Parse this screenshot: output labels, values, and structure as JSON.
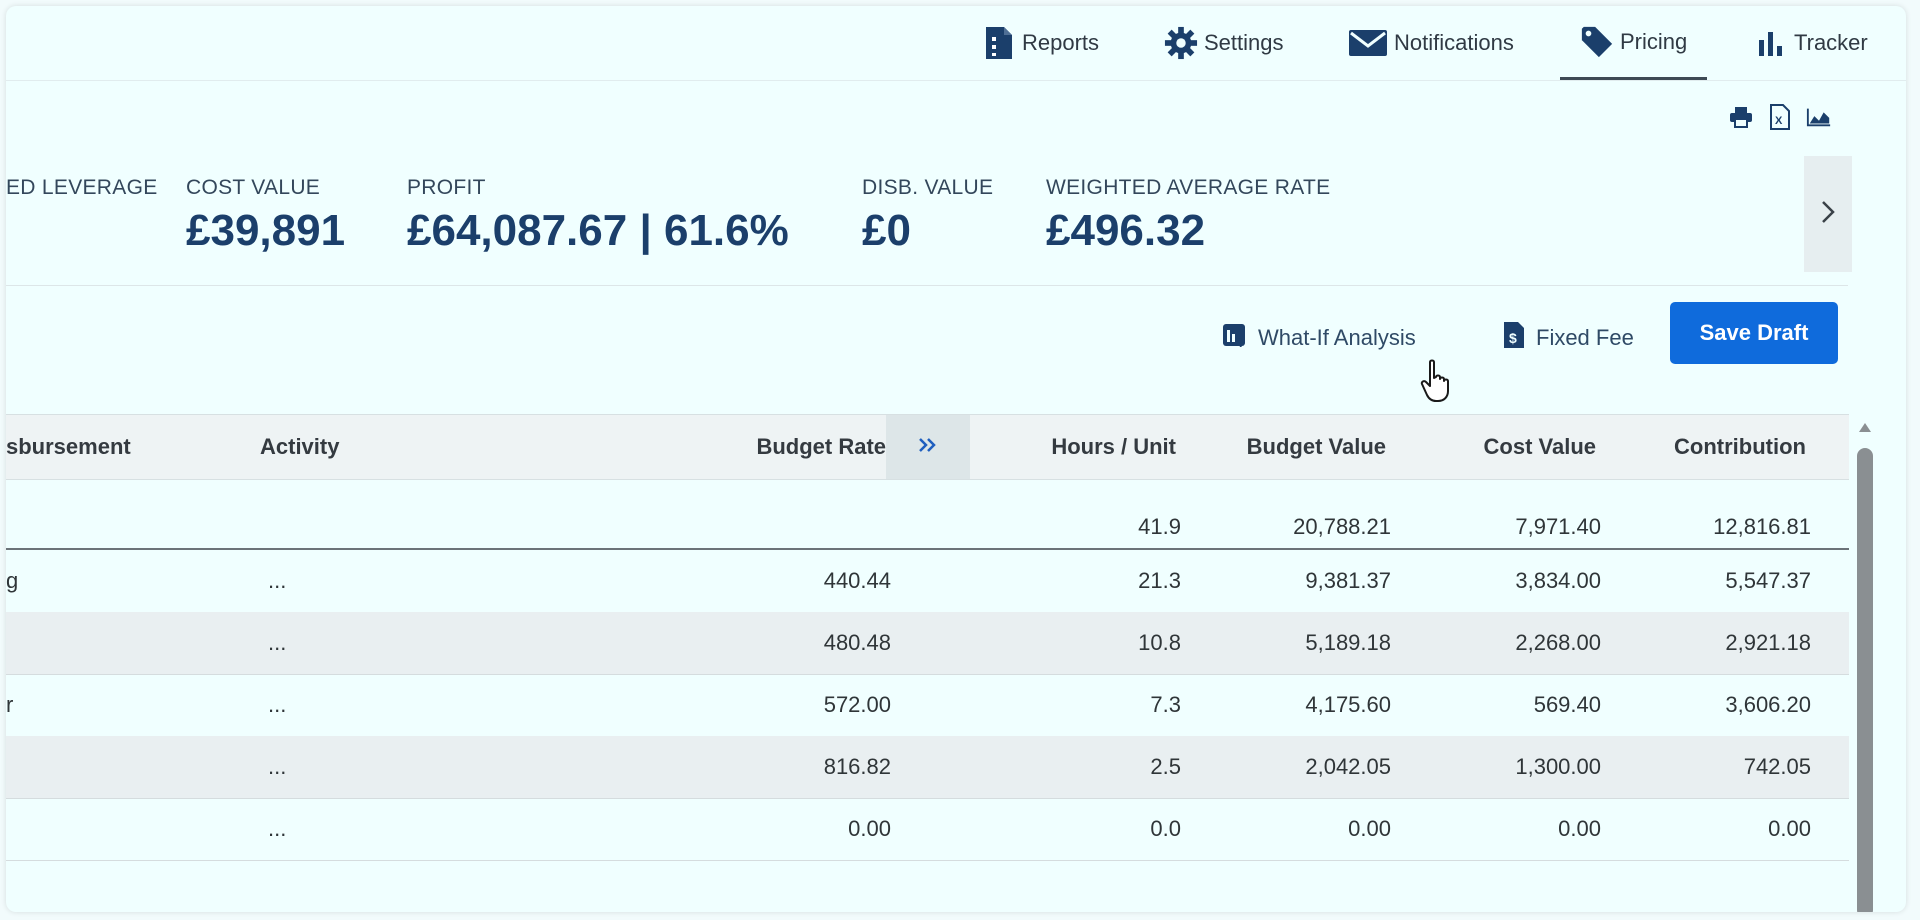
{
  "nav": {
    "items": [
      {
        "label": "Reports",
        "icon": "report-file-icon"
      },
      {
        "label": "Settings",
        "icon": "gear-icon"
      },
      {
        "label": "Notifications",
        "icon": "envelope-icon"
      },
      {
        "label": "Pricing",
        "icon": "price-tag-icon",
        "active": true
      },
      {
        "label": "Tracker",
        "icon": "bar-chart-icon"
      }
    ]
  },
  "utilities": [
    "print-icon",
    "excel-export-icon",
    "area-chart-icon"
  ],
  "summary": {
    "leverage": {
      "label": "ED LEVERAGE"
    },
    "cost_value": {
      "label": "COST VALUE",
      "value": "£39,891"
    },
    "profit": {
      "label": "PROFIT",
      "value": "£64,087.67 | 61.6%"
    },
    "disb_value": {
      "label": "DISB. VALUE",
      "value": "£0"
    },
    "weighted_rate": {
      "label": "WEIGHTED AVERAGE RATE",
      "value": "£496.32"
    }
  },
  "actions": {
    "what_if": "What-If Analysis",
    "fixed_fee": "Fixed Fee",
    "save_draft": "Save Draft"
  },
  "table": {
    "headers": {
      "disbursement": "sbursement",
      "activity": "Activity",
      "budget_rate": "Budget Rate",
      "hours": "Hours / Unit",
      "budget_value": "Budget Value",
      "cost_value": "Cost Value",
      "contribution": "Contribution"
    },
    "totals": {
      "hours": "41.9",
      "budget_value": "20,788.21",
      "cost_value": "7,971.40",
      "contribution": "12,816.81"
    },
    "rows": [
      {
        "partial": "g",
        "activity": "...",
        "budget_rate": "440.44",
        "hours": "21.3",
        "budget_value": "9,381.37",
        "cost_value": "3,834.00",
        "contribution": "5,547.37"
      },
      {
        "partial": "",
        "activity": "...",
        "budget_rate": "480.48",
        "hours": "10.8",
        "budget_value": "5,189.18",
        "cost_value": "2,268.00",
        "contribution": "2,921.18"
      },
      {
        "partial": "r",
        "activity": "...",
        "budget_rate": "572.00",
        "hours": "7.3",
        "budget_value": "4,175.60",
        "cost_value": "569.40",
        "contribution": "3,606.20"
      },
      {
        "partial": "",
        "activity": "...",
        "budget_rate": "816.82",
        "hours": "2.5",
        "budget_value": "2,042.05",
        "cost_value": "1,300.00",
        "contribution": "742.05"
      },
      {
        "partial": "",
        "activity": "...",
        "budget_rate": "0.00",
        "hours": "0.0",
        "budget_value": "0.00",
        "cost_value": "0.00",
        "contribution": "0.00"
      }
    ]
  },
  "colors": {
    "accent": "#0f6bdc",
    "nav_icon": "#1b3f6b",
    "kpi_value": "#1b3f6b",
    "background": "#f0ffff"
  }
}
